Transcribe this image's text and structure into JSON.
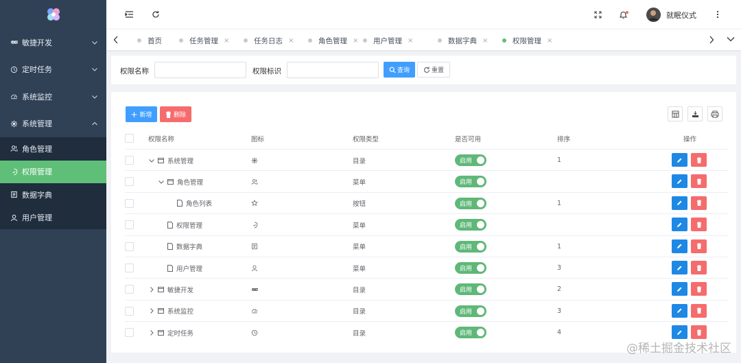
{
  "sidebar": {
    "colors": {
      "bg": "#304156",
      "sub_bg": "#1f2d3d",
      "active": "#5fbf79"
    },
    "items": [
      {
        "label": "敏捷开发",
        "icon": "infinity-icon",
        "expanded": false
      },
      {
        "label": "定时任务",
        "icon": "clock-icon",
        "expanded": false
      },
      {
        "label": "系统监控",
        "icon": "gauge-icon",
        "expanded": false
      },
      {
        "label": "系统管理",
        "icon": "gear-icon",
        "expanded": true
      }
    ],
    "subitems": [
      {
        "label": "角色管理",
        "icon": "users-icon",
        "active": false
      },
      {
        "label": "权限管理",
        "icon": "shield-icon",
        "active": true
      },
      {
        "label": "数据字典",
        "icon": "dictionary-icon",
        "active": false
      },
      {
        "label": "用户管理",
        "icon": "user-icon",
        "active": false
      }
    ]
  },
  "navbar": {
    "username": "就眠仪式"
  },
  "tags": [
    {
      "label": "首页",
      "closable": false,
      "active": false
    },
    {
      "label": "任务管理",
      "closable": true,
      "active": false
    },
    {
      "label": "任务日志",
      "closable": true,
      "active": false
    },
    {
      "label": "角色管理",
      "closable": true,
      "active": false
    },
    {
      "label": "用户管理",
      "closable": true,
      "active": false
    },
    {
      "label": "数据字典",
      "closable": true,
      "active": false
    },
    {
      "label": "权限管理",
      "closable": true,
      "active": true
    }
  ],
  "query": {
    "name_label": "权限名称",
    "name_value": "",
    "code_label": "权限标识",
    "code_value": "",
    "search_label": "查询",
    "reset_label": "重置"
  },
  "toolbar": {
    "add_label": "新增",
    "delete_label": "删除"
  },
  "table": {
    "headers": {
      "name": "权限名称",
      "icon": "图标",
      "type": "权限类型",
      "enabled": "是否可用",
      "sort": "排序",
      "ops": "操作"
    },
    "rows": [
      {
        "name": "系统管理",
        "level": 0,
        "expander": "down",
        "node": "folder",
        "icon": "gear-icon",
        "type": "目录",
        "enabled": "启用",
        "sort": "1"
      },
      {
        "name": "角色管理",
        "level": 1,
        "expander": "down",
        "node": "folder",
        "icon": "users-icon",
        "type": "菜单",
        "enabled": "启用",
        "sort": ""
      },
      {
        "name": "角色列表",
        "level": 2,
        "expander": "none",
        "node": "file",
        "icon": "star-icon",
        "type": "按钮",
        "enabled": "启用",
        "sort": "1"
      },
      {
        "name": "权限管理",
        "level": 1,
        "expander": "none",
        "node": "file",
        "icon": "shield-icon",
        "type": "菜单",
        "enabled": "启用",
        "sort": ""
      },
      {
        "name": "数据字典",
        "level": 1,
        "expander": "none",
        "node": "file",
        "icon": "dictionary-icon",
        "type": "菜单",
        "enabled": "启用",
        "sort": "1"
      },
      {
        "name": "用户管理",
        "level": 1,
        "expander": "none",
        "node": "file",
        "icon": "user-icon",
        "type": "菜单",
        "enabled": "启用",
        "sort": "3"
      },
      {
        "name": "敏捷开发",
        "level": 0,
        "expander": "right",
        "node": "folder",
        "icon": "infinity-icon",
        "type": "目录",
        "enabled": "启用",
        "sort": "2"
      },
      {
        "name": "系统监控",
        "level": 0,
        "expander": "right",
        "node": "folder",
        "icon": "gauge-icon",
        "type": "目录",
        "enabled": "启用",
        "sort": "3"
      },
      {
        "name": "定时任务",
        "level": 0,
        "expander": "right",
        "node": "folder",
        "icon": "clock-icon",
        "type": "目录",
        "enabled": "启用",
        "sort": "4"
      }
    ]
  },
  "watermark": "@稀土掘金技术社区"
}
